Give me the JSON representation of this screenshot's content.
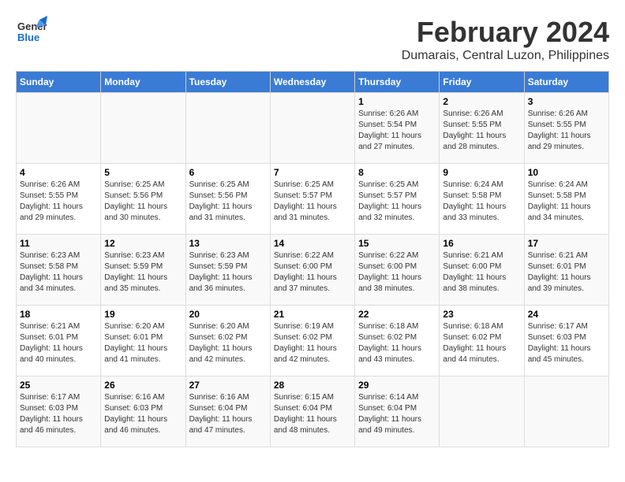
{
  "logo": {
    "line1": "General",
    "line2": "Blue"
  },
  "title": "February 2024",
  "subtitle": "Dumarais, Central Luzon, Philippines",
  "weekdays": [
    "Sunday",
    "Monday",
    "Tuesday",
    "Wednesday",
    "Thursday",
    "Friday",
    "Saturday"
  ],
  "weeks": [
    [
      {
        "day": "",
        "info": ""
      },
      {
        "day": "",
        "info": ""
      },
      {
        "day": "",
        "info": ""
      },
      {
        "day": "",
        "info": ""
      },
      {
        "day": "1",
        "info": "Sunrise: 6:26 AM\nSunset: 5:54 PM\nDaylight: 11 hours\nand 27 minutes."
      },
      {
        "day": "2",
        "info": "Sunrise: 6:26 AM\nSunset: 5:55 PM\nDaylight: 11 hours\nand 28 minutes."
      },
      {
        "day": "3",
        "info": "Sunrise: 6:26 AM\nSunset: 5:55 PM\nDaylight: 11 hours\nand 29 minutes."
      }
    ],
    [
      {
        "day": "4",
        "info": "Sunrise: 6:26 AM\nSunset: 5:55 PM\nDaylight: 11 hours\nand 29 minutes."
      },
      {
        "day": "5",
        "info": "Sunrise: 6:25 AM\nSunset: 5:56 PM\nDaylight: 11 hours\nand 30 minutes."
      },
      {
        "day": "6",
        "info": "Sunrise: 6:25 AM\nSunset: 5:56 PM\nDaylight: 11 hours\nand 31 minutes."
      },
      {
        "day": "7",
        "info": "Sunrise: 6:25 AM\nSunset: 5:57 PM\nDaylight: 11 hours\nand 31 minutes."
      },
      {
        "day": "8",
        "info": "Sunrise: 6:25 AM\nSunset: 5:57 PM\nDaylight: 11 hours\nand 32 minutes."
      },
      {
        "day": "9",
        "info": "Sunrise: 6:24 AM\nSunset: 5:58 PM\nDaylight: 11 hours\nand 33 minutes."
      },
      {
        "day": "10",
        "info": "Sunrise: 6:24 AM\nSunset: 5:58 PM\nDaylight: 11 hours\nand 34 minutes."
      }
    ],
    [
      {
        "day": "11",
        "info": "Sunrise: 6:23 AM\nSunset: 5:58 PM\nDaylight: 11 hours\nand 34 minutes."
      },
      {
        "day": "12",
        "info": "Sunrise: 6:23 AM\nSunset: 5:59 PM\nDaylight: 11 hours\nand 35 minutes."
      },
      {
        "day": "13",
        "info": "Sunrise: 6:23 AM\nSunset: 5:59 PM\nDaylight: 11 hours\nand 36 minutes."
      },
      {
        "day": "14",
        "info": "Sunrise: 6:22 AM\nSunset: 6:00 PM\nDaylight: 11 hours\nand 37 minutes."
      },
      {
        "day": "15",
        "info": "Sunrise: 6:22 AM\nSunset: 6:00 PM\nDaylight: 11 hours\nand 38 minutes."
      },
      {
        "day": "16",
        "info": "Sunrise: 6:21 AM\nSunset: 6:00 PM\nDaylight: 11 hours\nand 38 minutes."
      },
      {
        "day": "17",
        "info": "Sunrise: 6:21 AM\nSunset: 6:01 PM\nDaylight: 11 hours\nand 39 minutes."
      }
    ],
    [
      {
        "day": "18",
        "info": "Sunrise: 6:21 AM\nSunset: 6:01 PM\nDaylight: 11 hours\nand 40 minutes."
      },
      {
        "day": "19",
        "info": "Sunrise: 6:20 AM\nSunset: 6:01 PM\nDaylight: 11 hours\nand 41 minutes."
      },
      {
        "day": "20",
        "info": "Sunrise: 6:20 AM\nSunset: 6:02 PM\nDaylight: 11 hours\nand 42 minutes."
      },
      {
        "day": "21",
        "info": "Sunrise: 6:19 AM\nSunset: 6:02 PM\nDaylight: 11 hours\nand 42 minutes."
      },
      {
        "day": "22",
        "info": "Sunrise: 6:18 AM\nSunset: 6:02 PM\nDaylight: 11 hours\nand 43 minutes."
      },
      {
        "day": "23",
        "info": "Sunrise: 6:18 AM\nSunset: 6:02 PM\nDaylight: 11 hours\nand 44 minutes."
      },
      {
        "day": "24",
        "info": "Sunrise: 6:17 AM\nSunset: 6:03 PM\nDaylight: 11 hours\nand 45 minutes."
      }
    ],
    [
      {
        "day": "25",
        "info": "Sunrise: 6:17 AM\nSunset: 6:03 PM\nDaylight: 11 hours\nand 46 minutes."
      },
      {
        "day": "26",
        "info": "Sunrise: 6:16 AM\nSunset: 6:03 PM\nDaylight: 11 hours\nand 46 minutes."
      },
      {
        "day": "27",
        "info": "Sunrise: 6:16 AM\nSunset: 6:04 PM\nDaylight: 11 hours\nand 47 minutes."
      },
      {
        "day": "28",
        "info": "Sunrise: 6:15 AM\nSunset: 6:04 PM\nDaylight: 11 hours\nand 48 minutes."
      },
      {
        "day": "29",
        "info": "Sunrise: 6:14 AM\nSunset: 6:04 PM\nDaylight: 11 hours\nand 49 minutes."
      },
      {
        "day": "",
        "info": ""
      },
      {
        "day": "",
        "info": ""
      }
    ]
  ]
}
